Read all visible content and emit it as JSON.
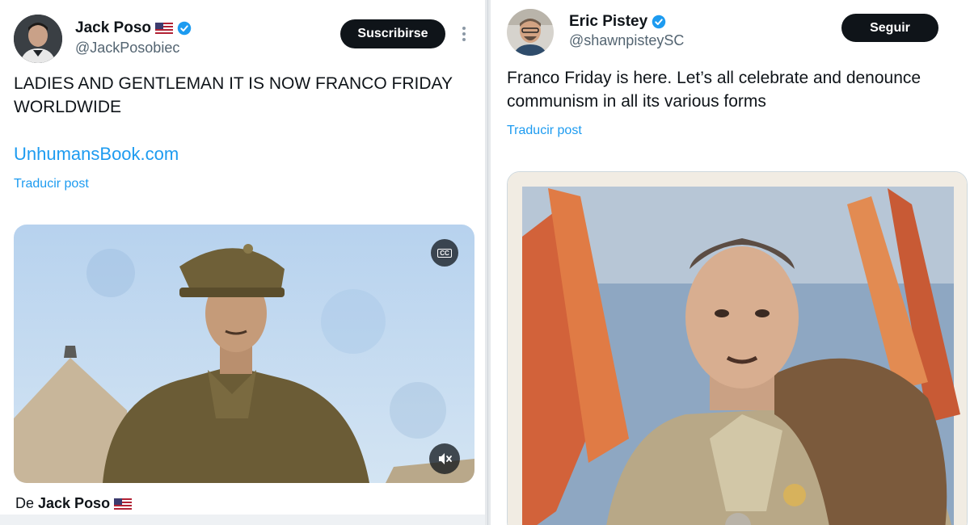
{
  "left_post": {
    "author": {
      "name": "Jack Poso",
      "handle": "@JackPosobiec",
      "verified": true,
      "flag": "US"
    },
    "action_button": "Suscribirse",
    "text": "LADIES AND GENTLEMAN IT IS NOW FRANCO FRIDAY WORLDWIDE",
    "link": "UnhumansBook.com",
    "translate_label": "Traducir post",
    "video": {
      "controls": [
        "closed-captions-icon",
        "mute-icon"
      ]
    },
    "attribution": {
      "prefix": "De",
      "name": "Jack Poso"
    }
  },
  "right_post": {
    "author": {
      "name": "Eric Pistey",
      "handle": "@shawnpisteySC",
      "verified": true
    },
    "action_button": "Seguir",
    "text": "Franco Friday is here. Let’s all celebrate and denounce communism in all its various forms",
    "translate_label": "Traducir post"
  },
  "colors": {
    "accent": "#1d9bf0",
    "button_bg": "#0f1419",
    "muted_text": "#536471"
  }
}
